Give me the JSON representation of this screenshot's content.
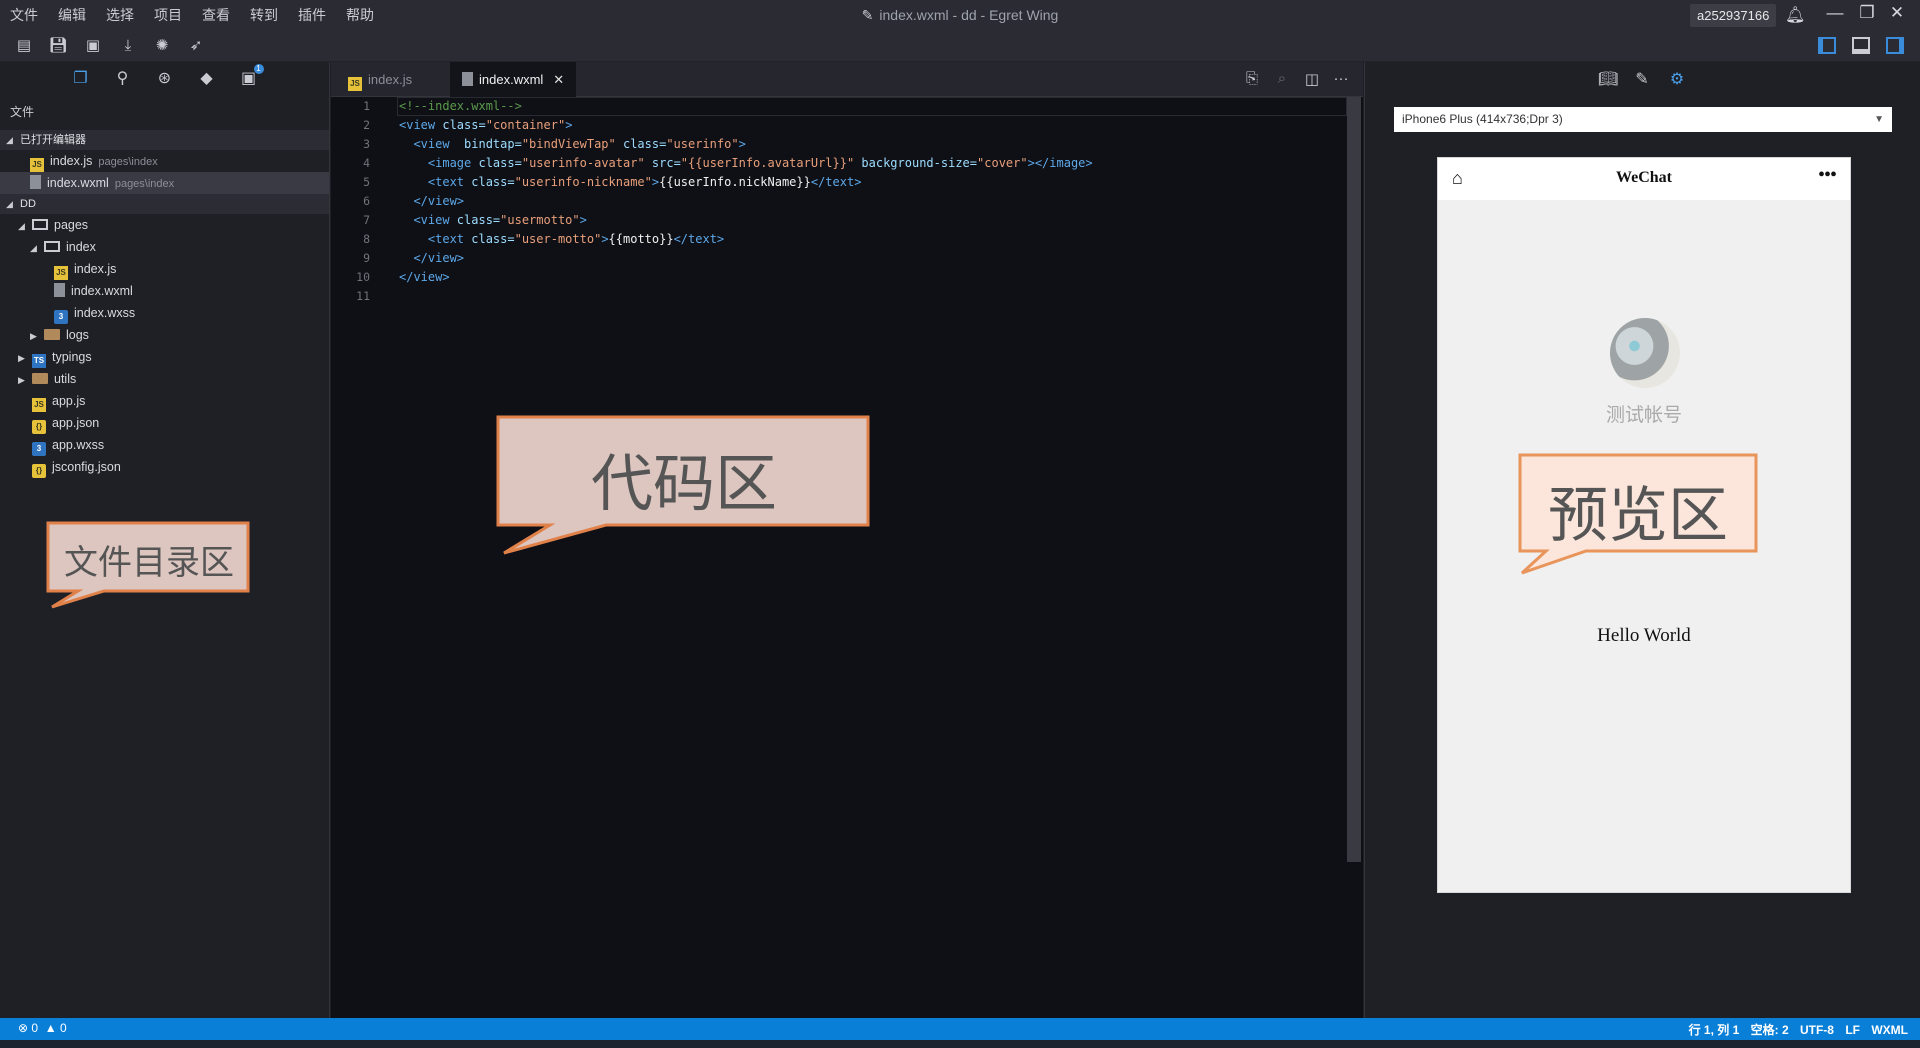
{
  "menu": [
    "文件",
    "编辑",
    "选择",
    "项目",
    "查看",
    "转到",
    "插件",
    "帮助"
  ],
  "window": {
    "title": "index.wxml - dd - Egret Wing",
    "user": "a252937166"
  },
  "sidebar": {
    "title": "文件",
    "open_editors_label": "已打开编辑器",
    "open_editors": [
      {
        "name": "index.js",
        "path": "pages\\index"
      },
      {
        "name": "index.wxml",
        "path": "pages\\index"
      }
    ],
    "project_label": "DD",
    "tree": {
      "pages": "pages",
      "index": "index",
      "index_js": "index.js",
      "index_wxml": "index.wxml",
      "index_wxss": "index.wxss",
      "logs": "logs",
      "typings": "typings",
      "utils": "utils",
      "app_js": "app.js",
      "app_json": "app.json",
      "app_wxss": "app.wxss",
      "jsconfig": "jsconfig.json"
    },
    "badge": "1"
  },
  "editor": {
    "tabs": [
      {
        "label": "index.js",
        "active": false
      },
      {
        "label": "index.wxml",
        "active": true
      }
    ],
    "line_numbers": [
      "1",
      "2",
      "3",
      "4",
      "5",
      "6",
      "7",
      "8",
      "9",
      "10",
      "11"
    ],
    "code": {
      "l1": "<!--index.wxml-->",
      "l2_tag": "<view ",
      "l2_attr": "class=",
      "l2_str": "\"container\"",
      "l2_end": ">",
      "l3_tag": "  <view  ",
      "l3_attr1": "bindtap=",
      "l3_str1": "\"bindViewTap\"",
      "l3_attr2": " class=",
      "l3_str2": "\"userinfo\"",
      "l3_end": ">",
      "l4_tag": "    <image ",
      "l4_attr1": "class=",
      "l4_str1": "\"userinfo-avatar\"",
      "l4_attr2": " src=",
      "l4_str2": "\"{{userInfo.avatarUrl}}\"",
      "l4_attr3": " background-size=",
      "l4_str3": "\"cover\"",
      "l4_end": "></image>",
      "l5_tag": "    <text ",
      "l5_attr": "class=",
      "l5_str": "\"userinfo-nickname\"",
      "l5_gt": ">",
      "l5_txt": "{{userInfo.nickName}}",
      "l5_end": "</text>",
      "l6": "  </view>",
      "l7_tag": "  <view ",
      "l7_attr": "class=",
      "l7_str": "\"usermotto\"",
      "l7_end": ">",
      "l8_tag": "    <text ",
      "l8_attr": "class=",
      "l8_str": "\"user-motto\"",
      "l8_gt": ">",
      "l8_txt": "{{motto}}",
      "l8_end": "</text>",
      "l9": "  </view>",
      "l10": "</view>"
    }
  },
  "preview": {
    "device": "iPhone6 Plus (414x736;Dpr 3)",
    "nav_title": "WeChat",
    "nickname": "测试帐号",
    "motto": "Hello World"
  },
  "callouts": {
    "files": "文件目录区",
    "code": "代码区",
    "preview": "预览区"
  },
  "statusbar": {
    "errors": "0",
    "warnings": "0",
    "position": "行 1, 列 1",
    "spaces": "空格: 2",
    "encoding": "UTF-8",
    "eol": "LF",
    "language": "WXML"
  },
  "colors": {
    "accent": "#0a7fd8",
    "callout_fill": "#ddc6c0",
    "callout_border": "#e0814a"
  }
}
